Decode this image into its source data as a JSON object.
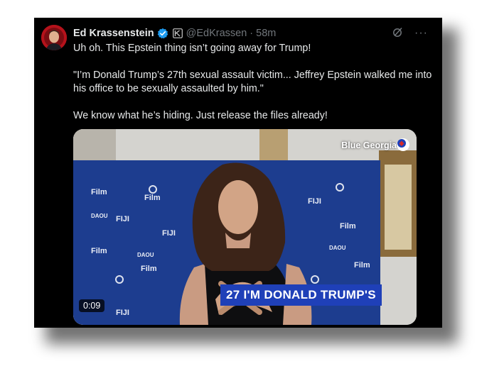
{
  "tweet": {
    "author": {
      "name": "Ed Krassenstein",
      "handle": "@EdKrassen",
      "separator": "·",
      "time": "58m"
    },
    "more_label": "···",
    "lines": [
      "Uh oh.  This Epstein thing isn’t going away for Trump!",
      "\"I’m Donald Trump’s 27th sexual assault victim... Jeffrey Epstein walked me into his office to be sexually assaulted by him.\"",
      "We know what he’s hiding.  Just release the files already!"
    ]
  },
  "video": {
    "source_label": "Blue Georgia",
    "caption": "27 I'M DONALD TRUMP'S",
    "duration": "0:09",
    "backdrop_words": [
      "Film",
      "FIJI",
      "DAOU"
    ]
  },
  "colors": {
    "background": "#000000",
    "text": "#e7e9ea",
    "muted": "#71767b",
    "verified": "#1d9bf0",
    "caption_bg": "#1f40b8",
    "backdrop": "#1d3d8f"
  },
  "icons": [
    "verified-badge-icon",
    "edit-tag-icon",
    "grok-icon",
    "more-icon",
    "channel-logo-icon"
  ]
}
